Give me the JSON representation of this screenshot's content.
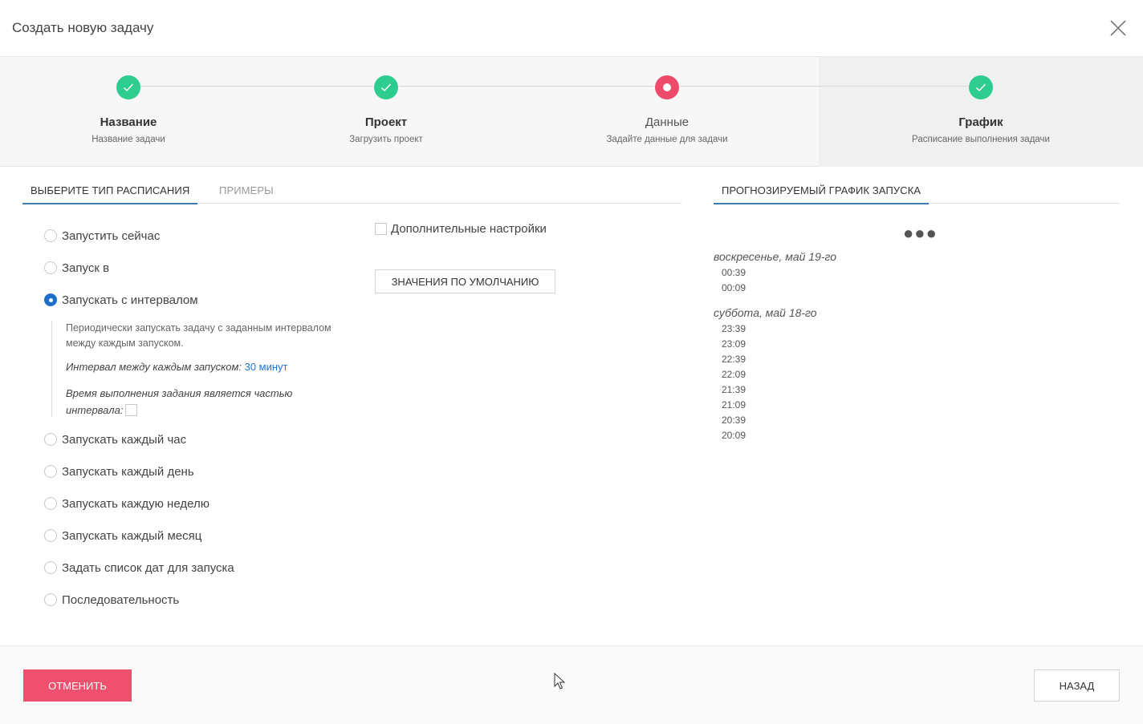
{
  "dialog": {
    "title": "Создать новую задачу",
    "close_icon": "close-icon"
  },
  "steps": [
    {
      "name": "Название",
      "sub": "Название задачи",
      "state": "done"
    },
    {
      "name": "Проект",
      "sub": "Загрузить проект",
      "state": "done"
    },
    {
      "name": "Данные",
      "sub": "Задайте данные для задачи",
      "state": "current"
    },
    {
      "name": "График",
      "sub": "Расписание выполнения задачи",
      "state": "done-active"
    }
  ],
  "tabs": {
    "schedule_type": "ВЫБЕРИТЕ ТИП РАСПИСАНИЯ",
    "examples": "ПРИМЕРЫ",
    "forecast": "ПРОГНОЗИРУЕМЫЙ ГРАФИК ЗАПУСКА"
  },
  "schedule_options": [
    {
      "label": "Запустить сейчас",
      "checked": false
    },
    {
      "label": "Запуск в",
      "checked": false
    },
    {
      "label": "Запускать с интервалом",
      "checked": true
    },
    {
      "label": "Запускать каждый час",
      "checked": false
    },
    {
      "label": "Запускать каждый день",
      "checked": false
    },
    {
      "label": "Запускать каждую неделю",
      "checked": false
    },
    {
      "label": "Запускать каждый месяц",
      "checked": false
    },
    {
      "label": "Задать список дат для запуска",
      "checked": false
    },
    {
      "label": "Последовательность",
      "checked": false
    }
  ],
  "interval": {
    "description": "Периодически запускать задачу с заданным интервалом между каждым запуском.",
    "interval_label": "Интервал между каждым запуском",
    "interval_value": "30 минут",
    "exec_part_label": "Время выполнения задания является частью интервала",
    "exec_part_checked": false
  },
  "advanced": {
    "label": "Дополнительные настройки",
    "checked": false
  },
  "defaults_button": "ЗНАЧЕНИЯ ПО УМОЛЧАНИЮ",
  "forecast": {
    "days": [
      {
        "heading": "воскресенье, май 19-го",
        "times": [
          "00:39",
          "00:09"
        ]
      },
      {
        "heading": "суббота, май 18-го",
        "times": [
          "23:39",
          "23:09",
          "22:39",
          "22:09",
          "21:39",
          "21:09",
          "20:39",
          "20:09"
        ]
      }
    ]
  },
  "footer": {
    "cancel": "ОТМЕНИТЬ",
    "back": "НАЗАД"
  },
  "colors": {
    "done": "#2ecc8f",
    "current": "#ee4b6a",
    "accent": "#1e6fc9",
    "cancel": "#ef506d"
  }
}
